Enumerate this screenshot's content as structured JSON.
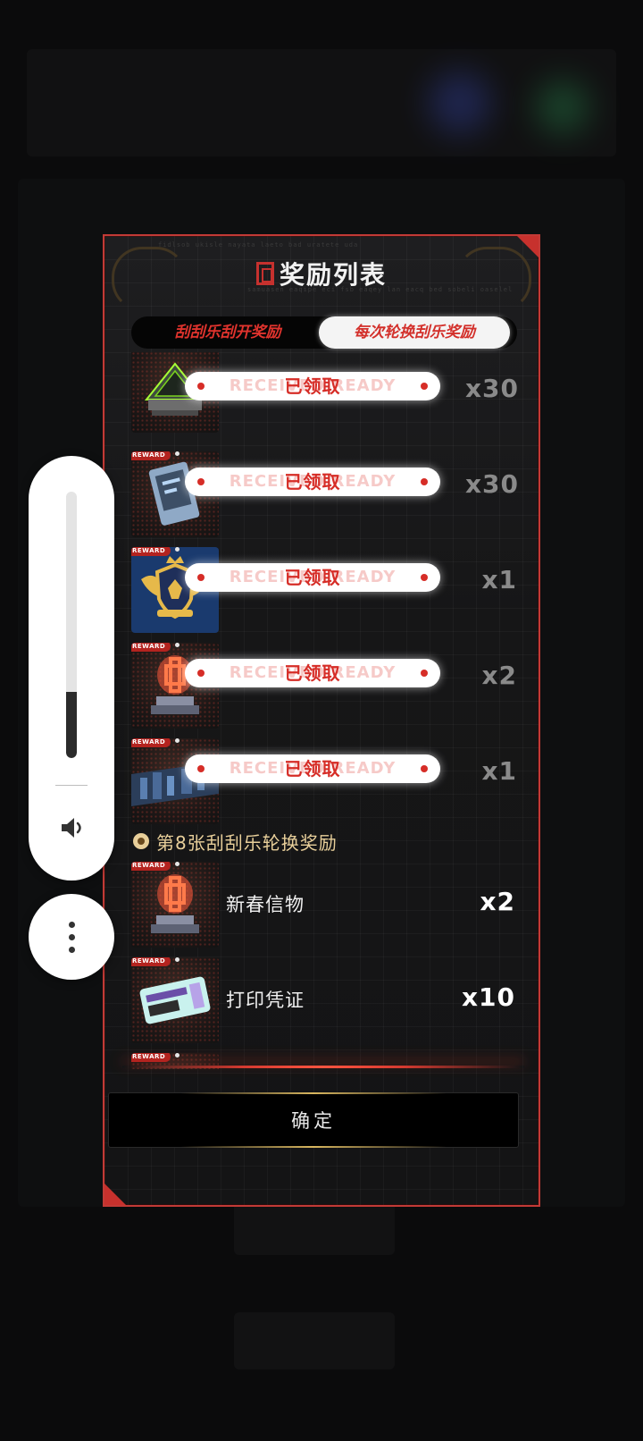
{
  "modal": {
    "title": "奖励列表",
    "tabs": [
      "刮刮乐刮开奖励",
      "每次轮换刮乐奖励"
    ],
    "active_tab": 1,
    "confirm_label": "确定"
  },
  "claimed_rows": [
    {
      "status": "已领取",
      "ghost": "RECEIVED  READY",
      "qty": "x30",
      "icon": "pyramid-device-icon"
    },
    {
      "status": "已领取",
      "ghost": "RECEIVED  READY",
      "qty": "x30",
      "icon": "data-card-icon"
    },
    {
      "status": "已领取",
      "ghost": "RECEIVED  READY",
      "qty": "x1",
      "icon": "crest-badge-icon"
    },
    {
      "status": "已领取",
      "ghost": "RECEIVED  READY",
      "qty": "x2",
      "icon": "knot-hologram-icon"
    },
    {
      "status": "已领取",
      "ghost": "RECEIVED  READY",
      "qty": "x1",
      "icon": "city-banner-icon"
    }
  ],
  "section": {
    "title": "第8张刮刮乐轮换奖励"
  },
  "items": [
    {
      "name": "新春信物",
      "qty": "x2",
      "icon": "knot-hologram-icon"
    },
    {
      "name": "打印凭证",
      "qty": "x10",
      "icon": "print-ticket-icon"
    }
  ],
  "reward_tag": "REWARD",
  "volume": {
    "level": 0.25
  },
  "colors": {
    "accent_red": "#d62d27",
    "gold": "#e8cf9a",
    "border": "#c23a36"
  }
}
